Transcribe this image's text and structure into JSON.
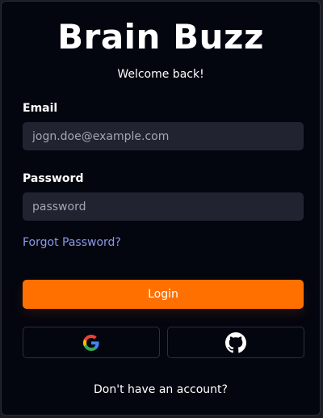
{
  "app": {
    "title": "Brain Buzz",
    "subtitle": "Welcome back!"
  },
  "form": {
    "email_label": "Email",
    "email_placeholder": "jogn.doe@example.com",
    "email_value": "",
    "password_label": "Password",
    "password_placeholder": "password",
    "password_value": "",
    "forgot_link": "Forgot Password?",
    "login_label": "Login"
  },
  "social": {
    "google_icon": "google-icon",
    "github_icon": "github-icon"
  },
  "footer": {
    "signup_prompt": "Don't have an account?"
  },
  "colors": {
    "background": "#03050f",
    "accent": "#ff7000",
    "link": "#8d9ae6",
    "input_bg": "#212430"
  }
}
